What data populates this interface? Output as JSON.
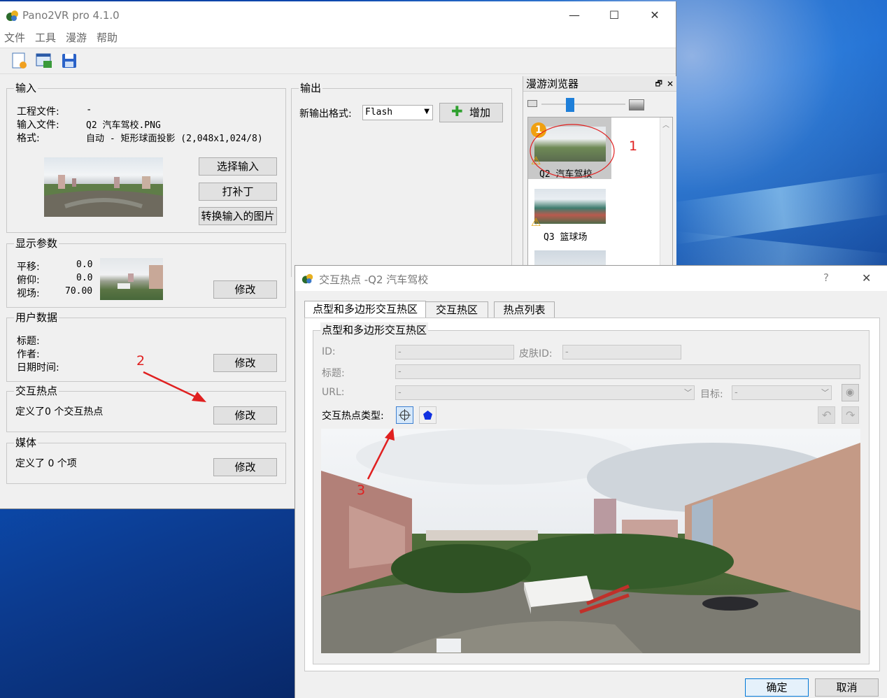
{
  "main_window": {
    "title": "Pano2VR pro 4.1.0",
    "menu": [
      "文件",
      "工具",
      "漫游",
      "帮助"
    ],
    "controls": {
      "minimize": "—",
      "maximize": "☐",
      "close": "✕"
    }
  },
  "input": {
    "label": "输入",
    "project_file_label": "工程文件:",
    "project_file_value": "-",
    "input_file_label": "输入文件:",
    "input_file_value": "Q2 汽车驾校.PNG",
    "format_label": "格式:",
    "format_value": "自动 - 矩形球面投影 (2,048x1,024/8)",
    "btn_select": "选择输入",
    "btn_patch": "打补丁",
    "btn_convert": "转换输入的图片"
  },
  "display": {
    "label": "显示参数",
    "pan_label": "平移:",
    "pan_value": "0.0",
    "tilt_label": "俯仰:",
    "tilt_value": "0.0",
    "fov_label": "视场:",
    "fov_value": "70.00",
    "btn_modify": "修改"
  },
  "userdata": {
    "label": "用户数据",
    "title_label": "标题:",
    "author_label": "作者:",
    "datetime_label": "日期时间:",
    "btn_modify": "修改"
  },
  "hotspots": {
    "label": "交互热点",
    "text": "定义了0 个交互热点",
    "btn_modify": "修改"
  },
  "media": {
    "label": "媒体",
    "text": "定义了 0 个项",
    "btn_modify": "修改"
  },
  "output": {
    "label": "输出",
    "new_format_label": "新输出格式:",
    "format_value": "Flash",
    "btn_add": "增加"
  },
  "tour_browser": {
    "title": "漫游浏览器",
    "items": [
      {
        "label": "Q2 汽车驾校",
        "badge": "1"
      },
      {
        "label": "Q3 篮球场"
      }
    ]
  },
  "dialog": {
    "title": "交互热点 -Q2 汽车驾校",
    "help": "?",
    "close": "✕",
    "tabs": [
      "点型和多边形交互热区",
      "交互热区",
      "热点列表"
    ],
    "group_label": "点型和多边形交互热区",
    "id_label": "ID:",
    "id_value": "-",
    "skin_id_label": "皮肤ID:",
    "skin_id_value": "-",
    "title_label": "标题:",
    "title_value": "-",
    "url_label": "URL:",
    "url_value": "-",
    "target_label": "目标:",
    "target_value": "-",
    "hotspot_type_label": "交互热点类型:",
    "ok": "确定",
    "cancel": "取消"
  },
  "annotations": [
    "1",
    "2",
    "3"
  ],
  "colors": {
    "annotation": "#e02020",
    "accent_blue": "#0078d7"
  }
}
